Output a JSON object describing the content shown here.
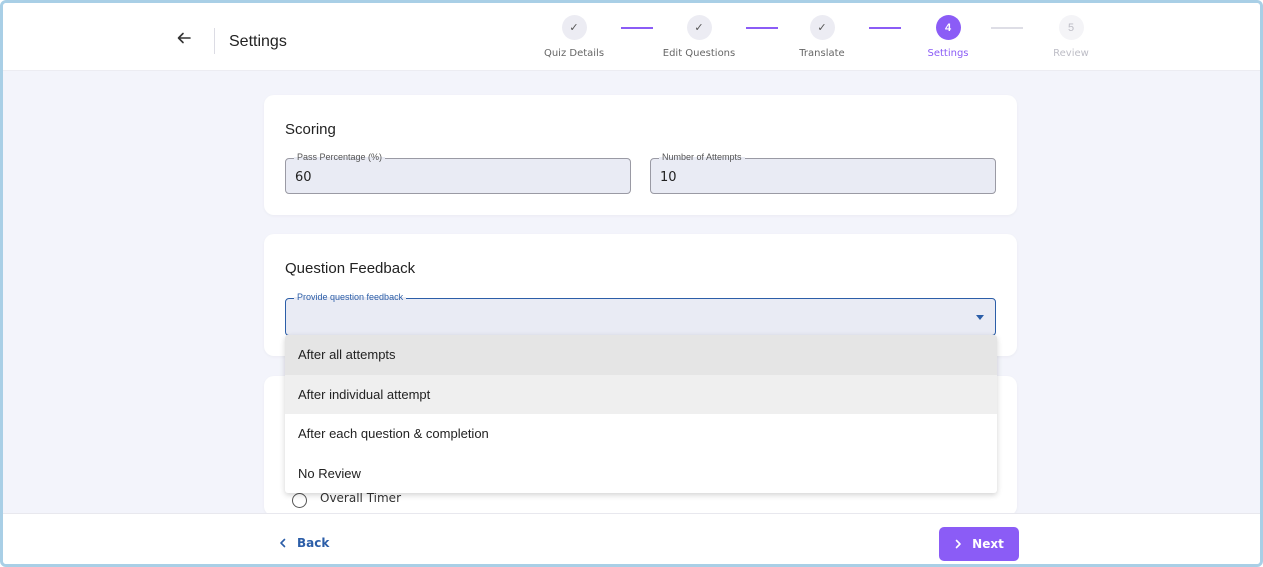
{
  "header": {
    "title": "Settings",
    "back_icon": "arrow-left-icon"
  },
  "stepper": {
    "steps": [
      {
        "label": "Quiz Details",
        "marker": "✓",
        "state": "done"
      },
      {
        "label": "Edit Questions",
        "marker": "✓",
        "state": "done"
      },
      {
        "label": "Translate",
        "marker": "✓",
        "state": "done"
      },
      {
        "label": "Settings",
        "marker": "4",
        "state": "active"
      },
      {
        "label": "Review",
        "marker": "5",
        "state": "future"
      }
    ]
  },
  "scoring": {
    "title": "Scoring",
    "pass_percentage": {
      "label": "Pass Percentage (%)",
      "value": "60"
    },
    "attempts": {
      "label": "Number of Attempts",
      "value": "10"
    }
  },
  "feedback": {
    "title": "Question Feedback",
    "select_label": "Provide question feedback",
    "options": [
      "After all attempts",
      "After individual attempt",
      "After each question & completion",
      "No Review"
    ]
  },
  "timer": {
    "overall_label": "Overall Timer"
  },
  "footer": {
    "back_label": "Back",
    "next_label": "Next"
  },
  "colors": {
    "accent": "#8b5cf6",
    "link": "#2c5ea8"
  }
}
